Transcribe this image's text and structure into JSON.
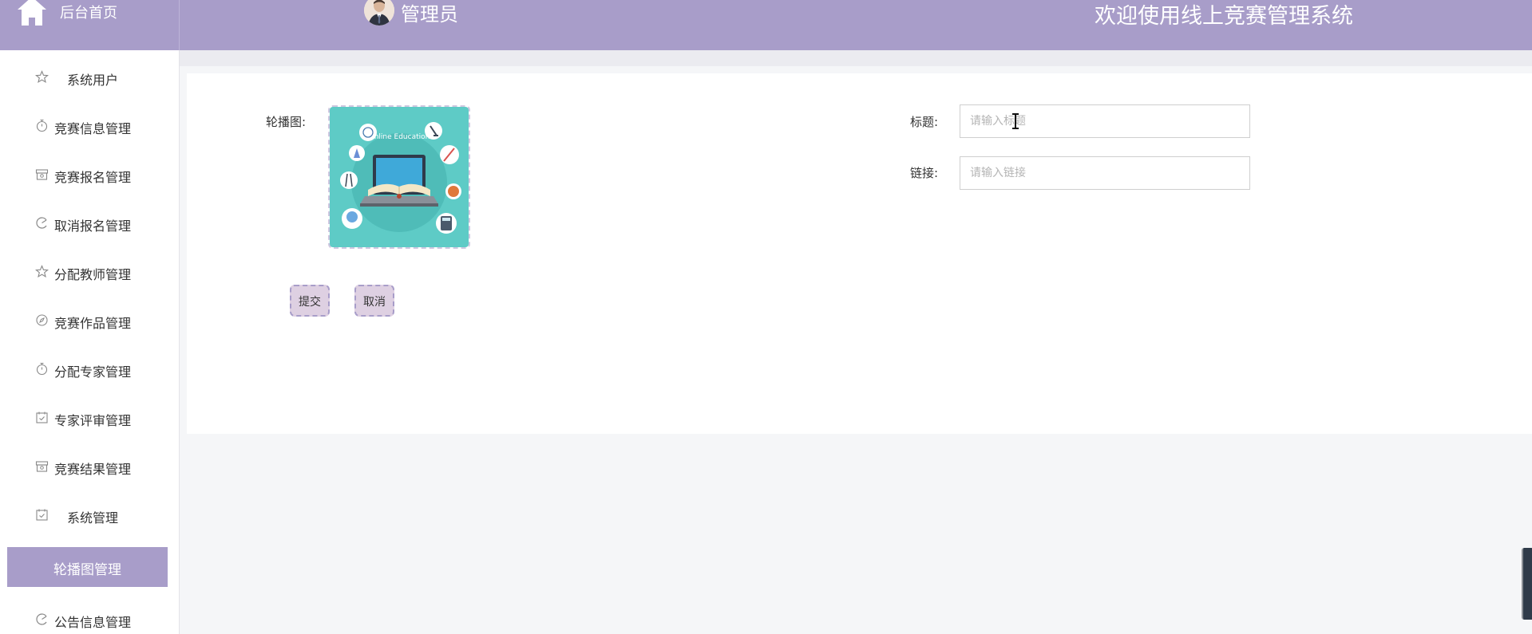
{
  "header": {
    "home_label": "后台首页",
    "admin_name": "管理员",
    "welcome_text": "欢迎使用线上竞赛管理系统",
    "brand_color": "#a89dc9"
  },
  "sidebar": {
    "items": [
      {
        "label": "系统用户",
        "icon": "star-icon"
      },
      {
        "label": "竞赛信息管理",
        "icon": "timer-icon"
      },
      {
        "label": "竞赛报名管理",
        "icon": "archive-icon"
      },
      {
        "label": "取消报名管理",
        "icon": "pie-icon"
      },
      {
        "label": "分配教师管理",
        "icon": "star-icon"
      },
      {
        "label": "竞赛作品管理",
        "icon": "compass-icon"
      },
      {
        "label": "分配专家管理",
        "icon": "timer-icon"
      },
      {
        "label": "专家评审管理",
        "icon": "calendar-check-icon"
      },
      {
        "label": "竞赛结果管理",
        "icon": "archive-icon"
      },
      {
        "label": "系统管理",
        "icon": "calendar-check-icon"
      },
      {
        "label": "轮播图管理",
        "active": true
      },
      {
        "label": "公告信息管理",
        "icon": "pie-icon"
      }
    ]
  },
  "form": {
    "carousel_label": "轮播图:",
    "carousel_image_text": "Online Education",
    "title_label": "标题:",
    "title_placeholder": "请输入标题",
    "title_value": "",
    "link_label": "链接:",
    "link_placeholder": "请输入链接",
    "link_value": "",
    "submit_label": "提交",
    "cancel_label": "取消"
  }
}
